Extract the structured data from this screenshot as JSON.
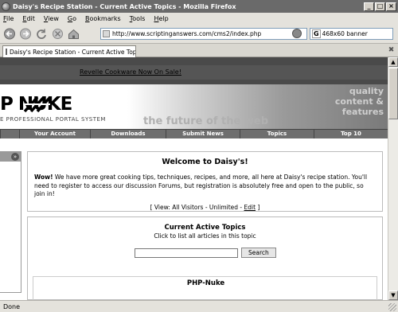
{
  "window": {
    "title": "Daisy's Recipe Station - Current Active Topics - Mozilla Firefox",
    "controls": [
      "_",
      "□",
      "×"
    ]
  },
  "menu": {
    "items": [
      {
        "label": "File",
        "accel": "F",
        "rest": "ile"
      },
      {
        "label": "Edit",
        "accel": "E",
        "rest": "dit"
      },
      {
        "label": "View",
        "accel": "V",
        "rest": "iew"
      },
      {
        "label": "Go",
        "accel": "G",
        "rest": "o"
      },
      {
        "label": "Bookmarks",
        "accel": "B",
        "rest": "ookmarks"
      },
      {
        "label": "Tools",
        "accel": "T",
        "rest": "ools"
      },
      {
        "label": "Help",
        "accel": "H",
        "rest": "elp"
      }
    ]
  },
  "toolbar": {
    "url": "http://www.scriptinganswers.com/cms2/index.php",
    "search_value": "468x60 banner",
    "search_engine_glyph": "G"
  },
  "tabs": {
    "active": "Daisy's Recipe Station - Current Active Topics"
  },
  "page": {
    "ad_link": "Revelle Cookware Now On Sale!",
    "logo": {
      "main": "P NUKE",
      "sub": "E PROFESSIONAL PORTAL SYSTEM"
    },
    "tagline": "the future of the web",
    "quality_lines": [
      "quality",
      "content &",
      "features"
    ],
    "nav": [
      "",
      "Your Account",
      "Downloads",
      "Submit News",
      "Topics",
      "Top 10"
    ],
    "left_panel_arrow": "»",
    "welcome": {
      "title": "Welcome to Daisy's!",
      "bold_lead": "Wow!",
      "body": " We have more great cooking tips, techniques, recipes, and more, all here at Daisy's recipe station. You'll need to register to access our discussion Forums, but registration is absolutely free and open to the public, so join in!",
      "view_prefix": "[ View: All Visitors - Unlimited - ",
      "view_link": "Edit",
      "view_suffix": " ]"
    },
    "topics": {
      "title": "Current Active Topics",
      "subtitle": "Click to list all articles in this topic",
      "search_button": "Search",
      "first_topic": "PHP-Nuke"
    }
  },
  "status": {
    "text": "Done"
  },
  "colors": {
    "titlebar": "#6a6a6a",
    "chrome": "#e4e2dc",
    "adbar": "#4a4a4a",
    "navstrip": "#6e6e6e"
  }
}
